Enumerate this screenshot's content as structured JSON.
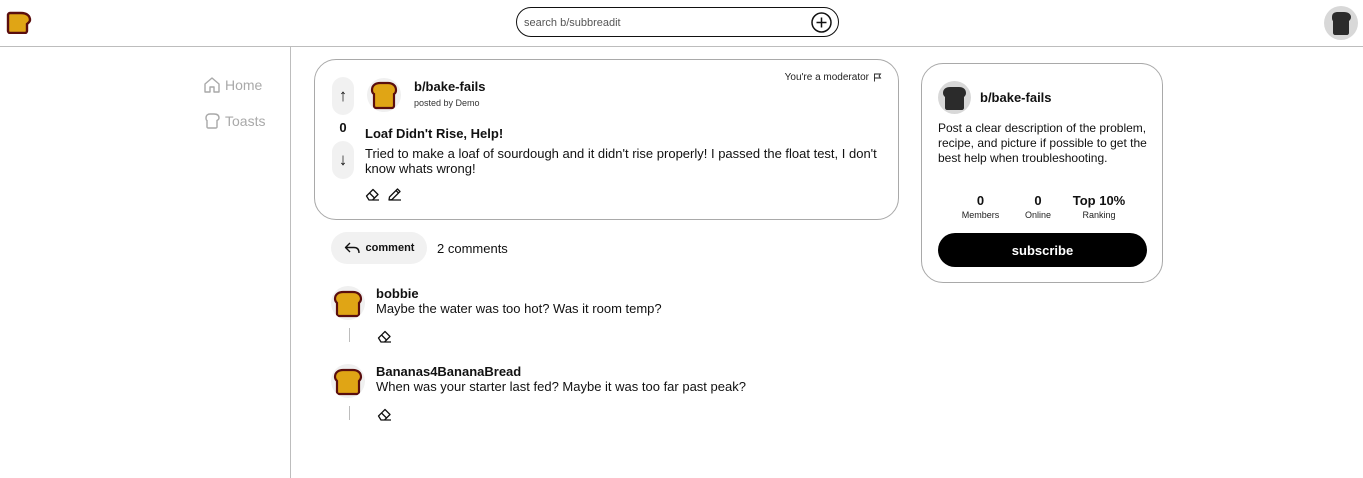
{
  "header": {
    "search_placeholder": "search b/subbreadit"
  },
  "sidebar": {
    "items": [
      {
        "label": "Home",
        "icon": "home-icon"
      },
      {
        "label": "Toasts",
        "icon": "toast-icon"
      }
    ]
  },
  "post": {
    "subbreadit": "b/bake-fails",
    "posted_by": "posted by Demo",
    "moderator_text": "You're a moderator",
    "vote_count": "0",
    "up_arrow": "↑",
    "down_arrow": "↓",
    "title": "Loaf Didn't Rise, Help!",
    "body": "Tried to make a loaf of sourdough and it didn't rise properly! I passed the float test, I don't know whats wrong!"
  },
  "comment_bar": {
    "button_label": "comment",
    "count_text": "2 comments"
  },
  "comments": [
    {
      "author": "bobbie",
      "text": "Maybe the water was too hot? Was it room temp?"
    },
    {
      "author": "Bananas4BananaBread",
      "text": "When was your starter last fed? Maybe it was too far past peak?"
    }
  ],
  "community": {
    "name": "b/bake-fails",
    "description": "Post a clear description of the problem, recipe, and picture if possible to get the best help when troubleshooting.",
    "stats": [
      {
        "value": "0",
        "label": "Members"
      },
      {
        "value": "0",
        "label": "Online"
      },
      {
        "value": "Top 10%",
        "label": "Ranking"
      }
    ],
    "subscribe_label": "subscribe"
  },
  "colors": {
    "toast_fill": "#E0A515",
    "toast_outline": "#5A0E0E",
    "dark_toast": "#2B2B2B",
    "border": "#A9A9A9"
  }
}
